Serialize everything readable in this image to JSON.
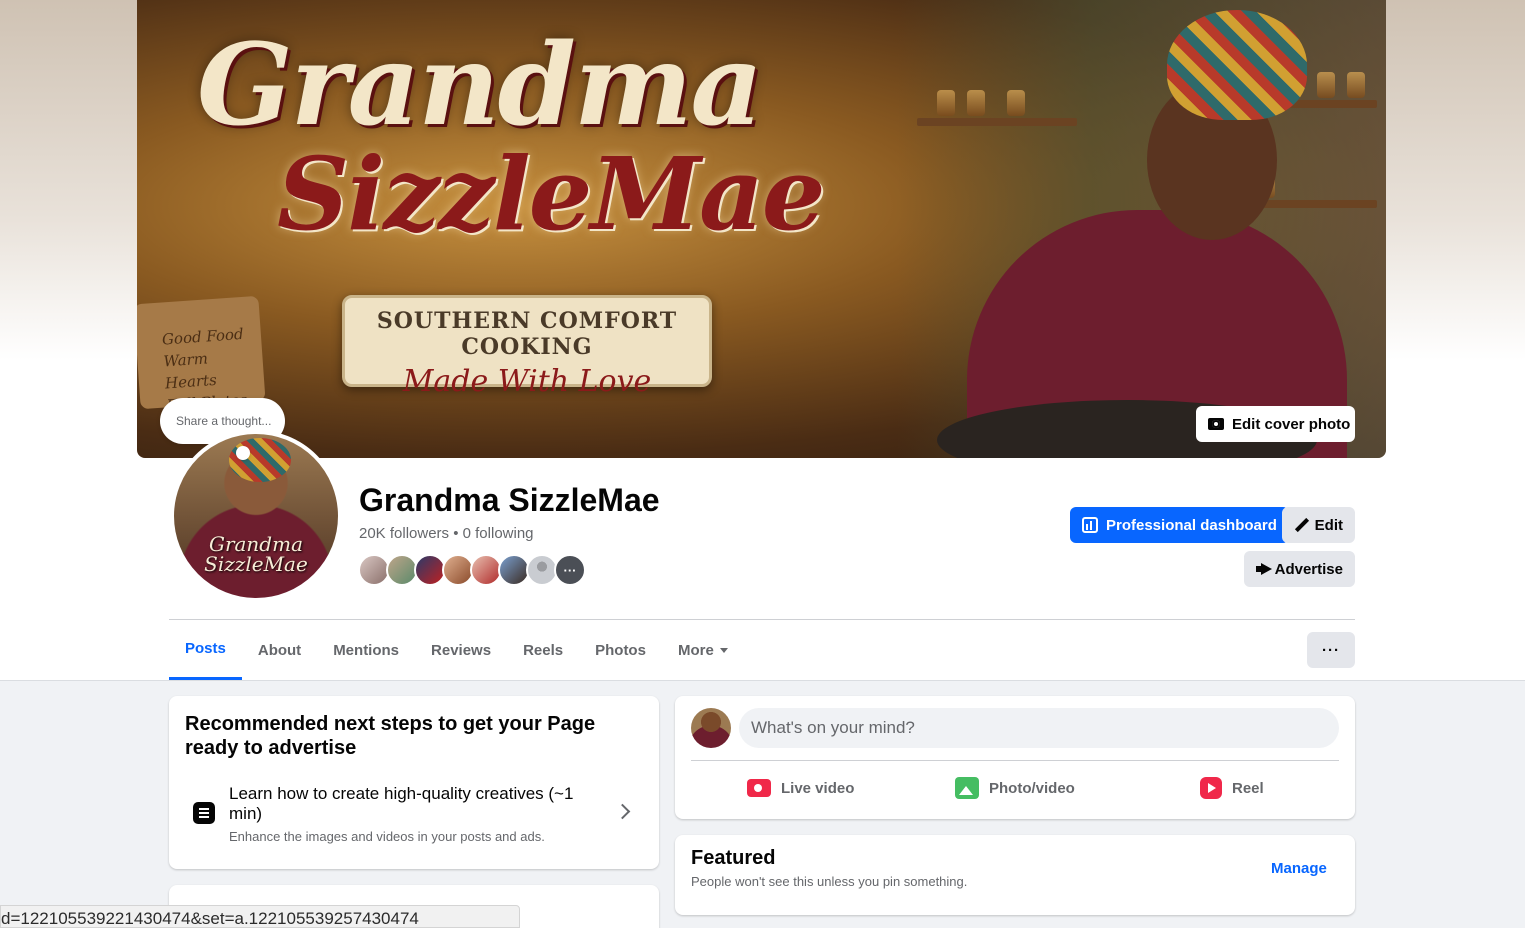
{
  "colors": {
    "accent": "#0866ff",
    "page_bg": "#f0f2f5",
    "card_bg": "#ffffff",
    "secondary_text": "#65676b"
  },
  "cover": {
    "headline_line1": "Grandma",
    "headline_line2": "SizzleMae",
    "banner_line1": "SOUTHERN COMFORT COOKING",
    "banner_line2": "Made With Love",
    "board_text": [
      "Good Food",
      "Warm Hearts",
      "Full Plates"
    ],
    "edit_cover_label": "Edit cover photo",
    "camera_icon": "camera-icon"
  },
  "thought_bubble": {
    "text": "Share a thought..."
  },
  "avatar": {
    "name_line1": "Grandma",
    "name_line2": "SizzleMae"
  },
  "profile": {
    "name": "Grandma SizzleMae",
    "stats": "20K followers • 0 following",
    "follower_avatars_more": "···"
  },
  "actions": {
    "professional_dashboard": "Professional dashboard",
    "edit": "Edit",
    "advertise": "Advertise"
  },
  "tabs": [
    {
      "label": "Posts",
      "active": true
    },
    {
      "label": "About",
      "active": false
    },
    {
      "label": "Mentions",
      "active": false
    },
    {
      "label": "Reviews",
      "active": false
    },
    {
      "label": "Reels",
      "active": false
    },
    {
      "label": "Photos",
      "active": false
    },
    {
      "label": "More",
      "active": false
    }
  ],
  "tabs_more_button": "···",
  "recommended": {
    "title": "Recommended next steps to get your Page ready to advertise",
    "item_title": "Learn how to create high-quality creatives (~1 min)",
    "item_subtitle": "Enhance the images and videos in your posts and ads."
  },
  "composer": {
    "placeholder": "What's on your mind?",
    "live_video": "Live video",
    "photo_video": "Photo/video",
    "reel": "Reel"
  },
  "featured": {
    "title": "Featured",
    "subtitle": "People won't see this unless you pin something.",
    "manage": "Manage"
  },
  "status_bar": {
    "url_text": "d=122105539221430474&set=a.122105539257430474"
  }
}
